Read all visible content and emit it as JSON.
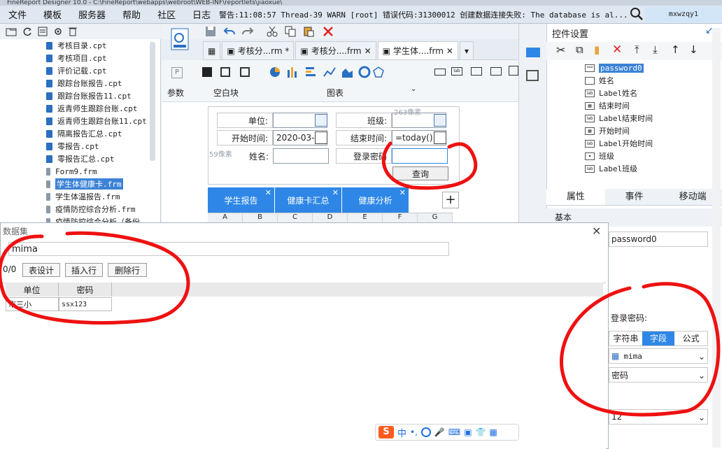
{
  "titlebar": "FineReport Designer 10.0 - C:\\FineReport\\webapps\\webroot\\WEB-INF\\reportlets\\jiaoxue\\",
  "menu": [
    "文件",
    "模板",
    "服务器",
    "帮助",
    "社区",
    "日志"
  ],
  "log_text": "警告:11:08:57 Thread-39 WARN [root] 错误代码:31300012 创建数据连接失败: The database is al...",
  "user": "mxwzqy1",
  "tree": [
    {
      "label": "考核目录.cpt",
      "type": "cpt"
    },
    {
      "label": "考核项目.cpt",
      "type": "cpt"
    },
    {
      "label": "评价记载.cpt",
      "type": "cpt"
    },
    {
      "label": "跟踪台账报告.cpt",
      "type": "cpt"
    },
    {
      "label": "跟踪台账报告11.cpt",
      "type": "cpt"
    },
    {
      "label": "返青师生跟踪台账.cpt",
      "type": "cpt"
    },
    {
      "label": "返青师生跟踪台账11.cpt",
      "type": "cpt"
    },
    {
      "label": "隔离报告汇总.cpt",
      "type": "cpt"
    },
    {
      "label": "零报告.cpt",
      "type": "cpt"
    },
    {
      "label": "零报告汇总.cpt",
      "type": "cpt"
    },
    {
      "label": "Form9.frm",
      "type": "frm"
    },
    {
      "label": "学生体健康卡.frm",
      "type": "frm",
      "selected": true
    },
    {
      "label": "学生体温报告.frm",
      "type": "frm"
    },
    {
      "label": "疫情防控综合分析.frm",
      "type": "frm"
    },
    {
      "label": "疫情防控综合分析（备份",
      "type": "frm"
    }
  ],
  "tabs": [
    {
      "label": "考核分...rm *"
    },
    {
      "label": "考核分....frm"
    },
    {
      "label": "学生体....frm",
      "active": true
    }
  ],
  "widget_groups": {
    "params": "参数",
    "blank": "空白块",
    "chart": "图表"
  },
  "form": {
    "unit_label": "单位:",
    "class_label": "班级:",
    "start_label": "开始时间:",
    "start_value": "2020-03-",
    "end_label": "结束时间:",
    "end_value": "=today()",
    "name_label": "姓名:",
    "pwd_label": "登录密码",
    "query_button": "查询",
    "hint_263": "263像素",
    "hint_59": "59像素"
  },
  "sheet_tabs": [
    "学生报告",
    "健康卡汇总",
    "健康分析"
  ],
  "columns": [
    "A",
    "B",
    "C",
    "D",
    "E",
    "F",
    "G"
  ],
  "dialog": {
    "title": "数据集",
    "name": "mima",
    "count": "0/0",
    "buttons": [
      "表设计",
      "插入行",
      "删除行"
    ],
    "headers": [
      "单位",
      "密码"
    ],
    "rows": [
      [
        "市三小",
        "ssx123"
      ]
    ]
  },
  "right": {
    "title": "控件设置",
    "controls": [
      {
        "label": "password0",
        "icon": "***",
        "selected": true
      },
      {
        "label": "姓名",
        "icon": ""
      },
      {
        "label": "Label姓名",
        "icon": "lab"
      },
      {
        "label": "结束时间",
        "icon": "▦"
      },
      {
        "label": "Label结束时间",
        "icon": "lab"
      },
      {
        "label": "开始时间",
        "icon": "▦"
      },
      {
        "label": "Label开始时间",
        "icon": "lab"
      },
      {
        "label": "班级",
        "icon": "▾"
      },
      {
        "label": "Label班级",
        "icon": "lab"
      }
    ],
    "prop_tabs": [
      "属性",
      "事件",
      "移动端"
    ],
    "basic": "基本",
    "widget_name": "password0",
    "pwd_label": "登录密码:",
    "seg": [
      "字符串",
      "字段",
      "公式"
    ],
    "seg_selected": "字段",
    "dataset_value": "mima",
    "field_value": "密码",
    "font_size": "12"
  },
  "ime": {
    "logo": "S",
    "lang": "中"
  }
}
